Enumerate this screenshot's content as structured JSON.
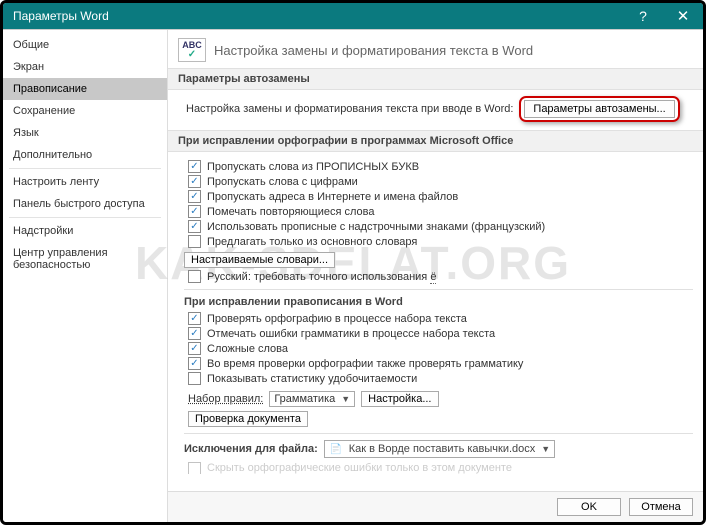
{
  "window": {
    "title": "Параметры Word"
  },
  "watermark": "KAK-SDELAT.ORG",
  "sidebar": {
    "groups": [
      [
        "Общие",
        "Экран",
        "Правописание",
        "Сохранение",
        "Язык",
        "Дополнительно"
      ],
      [
        "Настроить ленту",
        "Панель быстрого доступа"
      ],
      [
        "Надстройки",
        "Центр управления безопасностью"
      ]
    ],
    "selected": "Правописание"
  },
  "header": {
    "title": "Настройка замены и форматирования текста в Word",
    "icon_top": "ABC"
  },
  "sections": {
    "autocorrect": {
      "head": "Параметры автозамены",
      "desc": "Настройка замены и форматирования текста при вводе в Word:",
      "button": "Параметры автозамены..."
    },
    "office_spell": {
      "head": "При исправлении орфографии в программах Microsoft Office",
      "checks": [
        {
          "label": "Пропускать слова из ПРОПИСНЫХ БУКВ",
          "checked": true
        },
        {
          "label": "Пропускать слова с цифрами",
          "checked": true
        },
        {
          "label": "Пропускать адреса в Интернете и имена файлов",
          "checked": true
        },
        {
          "label": "Помечать повторяющиеся слова",
          "checked": true
        },
        {
          "label": "Использовать прописные с надстрочными знаками (французский)",
          "checked": true
        },
        {
          "label": "Предлагать только из основного словаря",
          "checked": false
        }
      ],
      "dict_button": "Настраиваемые словари...",
      "ru_strict": {
        "label_pre": "Русский: требовать точного использования ",
        "label_u": "ё",
        "checked": false
      }
    },
    "word_spell": {
      "head": "При исправлении правописания в Word",
      "checks": [
        {
          "label": "Проверять орфографию в процессе набора текста",
          "checked": true
        },
        {
          "label": "Отмечать ошибки грамматики в процессе набора текста",
          "checked": true
        },
        {
          "label": "Сложные слова",
          "checked": true
        },
        {
          "label": "Во время проверки орфографии также проверять грамматику",
          "checked": true
        },
        {
          "label": "Показывать статистику удобочитаемости",
          "checked": false
        }
      ],
      "ruleset_label": "Набор правил:",
      "ruleset_value": "Грамматика",
      "settings_btn": "Настройка...",
      "check_doc_btn": "Проверка документа"
    },
    "exceptions": {
      "head_pre": "Исключения для файла:",
      "file": "Как в Ворде поставить кавычки.docx",
      "truncated": "Скрыть орфографические ошибки только в этом документе"
    }
  },
  "footer": {
    "ok": "OK",
    "cancel": "Отмена"
  }
}
